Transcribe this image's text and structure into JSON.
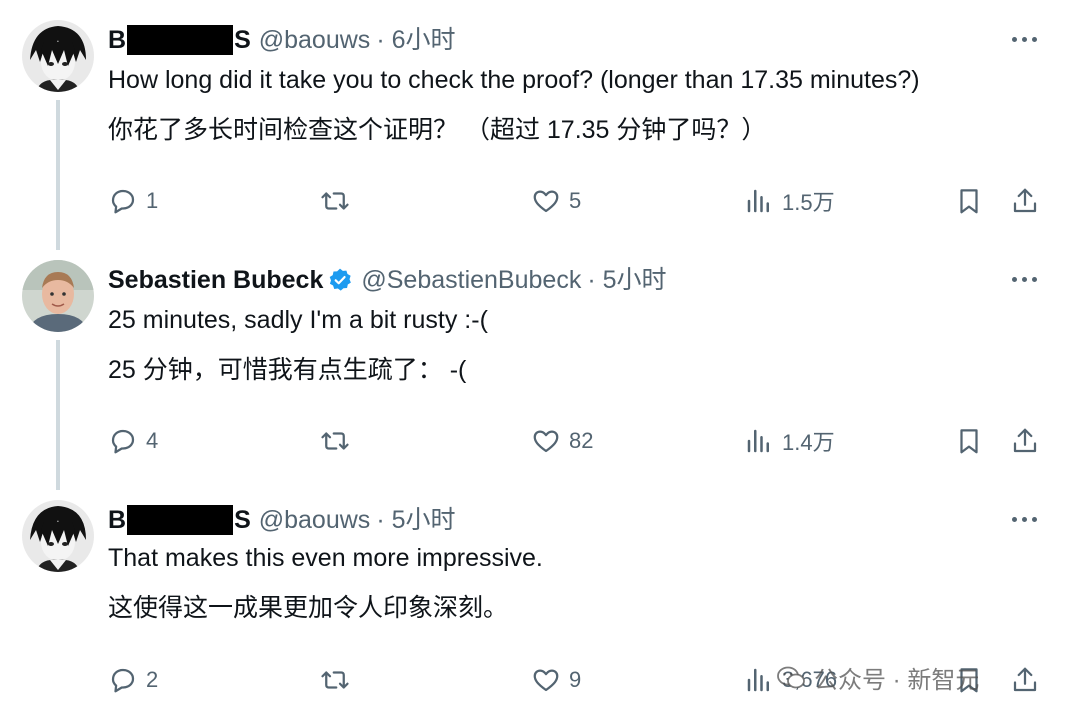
{
  "tweets": [
    {
      "name_first": "B",
      "name_last": "S",
      "handle": "@baouws",
      "time": "· 6小时",
      "text_en": "How long did it take you to check the proof?  (longer than 17.35 minutes?)",
      "text_zh": "你花了多长时间检查这个证明？ （超过 17.35 分钟了吗？）",
      "replies": "1",
      "retweets": "",
      "likes": "5",
      "views": "1.5万"
    },
    {
      "name": "Sebastien Bubeck",
      "handle": "@SebastienBubeck",
      "time": "· 5小时",
      "text_en": "25 minutes, sadly I'm a bit rusty :-(",
      "text_zh": "25 分钟，可惜我有点生疏了： -(",
      "replies": "4",
      "retweets": "",
      "likes": "82",
      "views": "1.4万"
    },
    {
      "name_first": "B",
      "name_last": "S",
      "handle": "@baouws",
      "time": "· 5小时",
      "text_en": "That makes this even more impressive.",
      "text_zh": "这使得这一成果更加令人印象深刻。",
      "replies": "2",
      "retweets": "",
      "likes": "9",
      "views": "3,676"
    }
  ],
  "watermark": "公众号 · 新智元",
  "colors": {
    "text": "#0f1419",
    "muted": "#536471",
    "verified": "#1d9bf0",
    "thread_line": "#cfd9de"
  },
  "icons": [
    "reply-icon",
    "retweet-icon",
    "like-icon",
    "views-icon",
    "bookmark-icon",
    "share-icon",
    "more-icon",
    "verified-icon"
  ]
}
